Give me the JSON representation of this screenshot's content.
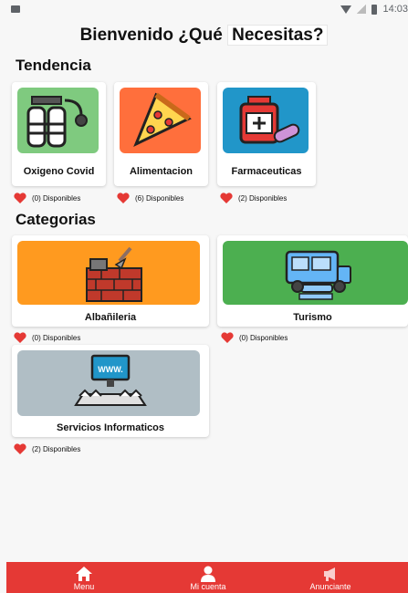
{
  "status_bar": {
    "time": "14:03"
  },
  "header": {
    "title_prefix": "Bienvenido ¿Qué",
    "title_highlight": "Necesitas?"
  },
  "tendencia": {
    "title": "Tendencia",
    "items": [
      {
        "name": "Oxigeno Covid",
        "icon": "oxygen-tanks-icon",
        "color": "#7fca7f",
        "availability": "(0) Disponibles"
      },
      {
        "name": "Alimentacion",
        "icon": "pizza-icon",
        "color": "#ff6f3c",
        "availability": "(6) Disponibles"
      },
      {
        "name": "Farmaceuticas",
        "icon": "medicine-icon",
        "color": "#2196c9",
        "availability": "(2) Disponibles"
      }
    ]
  },
  "categorias": {
    "title": "Categorias",
    "items": [
      {
        "name": "Albañileria",
        "icon": "brick-wall-icon",
        "color": "#ff9a1f",
        "availability": "(0) Disponibles"
      },
      {
        "name": "Turismo",
        "icon": "bus-icon",
        "color": "#4caf50",
        "availability": "(0) Disponibles"
      },
      {
        "name": "Servicios Informaticos",
        "icon": "computer-www-icon",
        "color": "#b0bec5",
        "availability": "(2) Disponibles"
      }
    ]
  },
  "navbar": {
    "color": "#e53935",
    "items": [
      {
        "label": "Menu",
        "icon": "home-icon"
      },
      {
        "label": "Mi cuenta",
        "icon": "user-icon"
      },
      {
        "label": "Anunciante",
        "icon": "megaphone-icon"
      }
    ]
  }
}
